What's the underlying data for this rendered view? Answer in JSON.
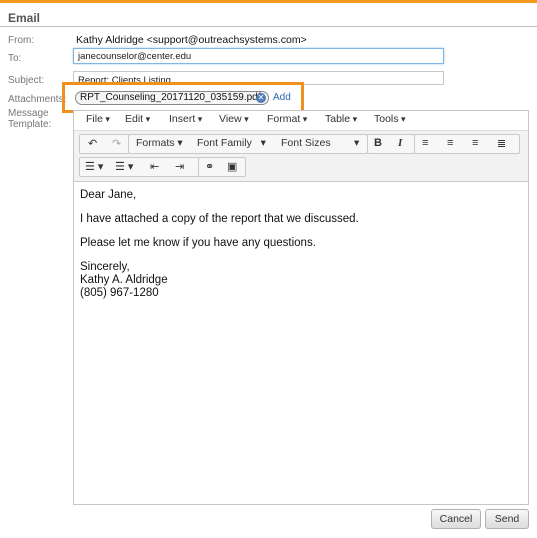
{
  "header": {
    "title": "Email",
    "accent_color": "#f29a1f"
  },
  "form": {
    "from_label": "From:",
    "from_value": "Kathy Aldridge <support@outreachsystems.com>",
    "to_label": "To:",
    "to_value": "janecounselor@center.edu",
    "subject_label": "Subject:",
    "subject_value": "Report: Clients Listing",
    "attachments_label": "Attachments:",
    "attachment_file": "RPT_Counseling_20171120_035159.pdf",
    "add_label": "Add",
    "template_label_1": "Message",
    "template_label_2": "Template:"
  },
  "editor": {
    "menus": [
      "File",
      "Edit",
      "Insert",
      "View",
      "Format",
      "Table",
      "Tools"
    ],
    "formats_label": "Formats",
    "font_family_label": "Font Family",
    "font_sizes_label": "Font Sizes",
    "bold_label": "B",
    "italic_label": "I",
    "body": {
      "greeting": "Dear Jane,",
      "line1": "I have attached a copy of the report that we discussed.",
      "line2": "Please let me know if you have any questions.",
      "closing": "Sincerely,",
      "name": "Kathy A. Aldridge",
      "phone": "(805) 967-1280"
    }
  },
  "buttons": {
    "cancel": "Cancel",
    "send": "Send"
  },
  "icons": [
    "undo-icon",
    "redo-icon",
    "align-left-icon",
    "align-center-icon",
    "align-right-icon",
    "align-justify-icon",
    "bullet-list-icon",
    "numbered-list-icon",
    "outdent-icon",
    "indent-icon",
    "link-icon",
    "image-icon",
    "remove-attachment-icon"
  ]
}
